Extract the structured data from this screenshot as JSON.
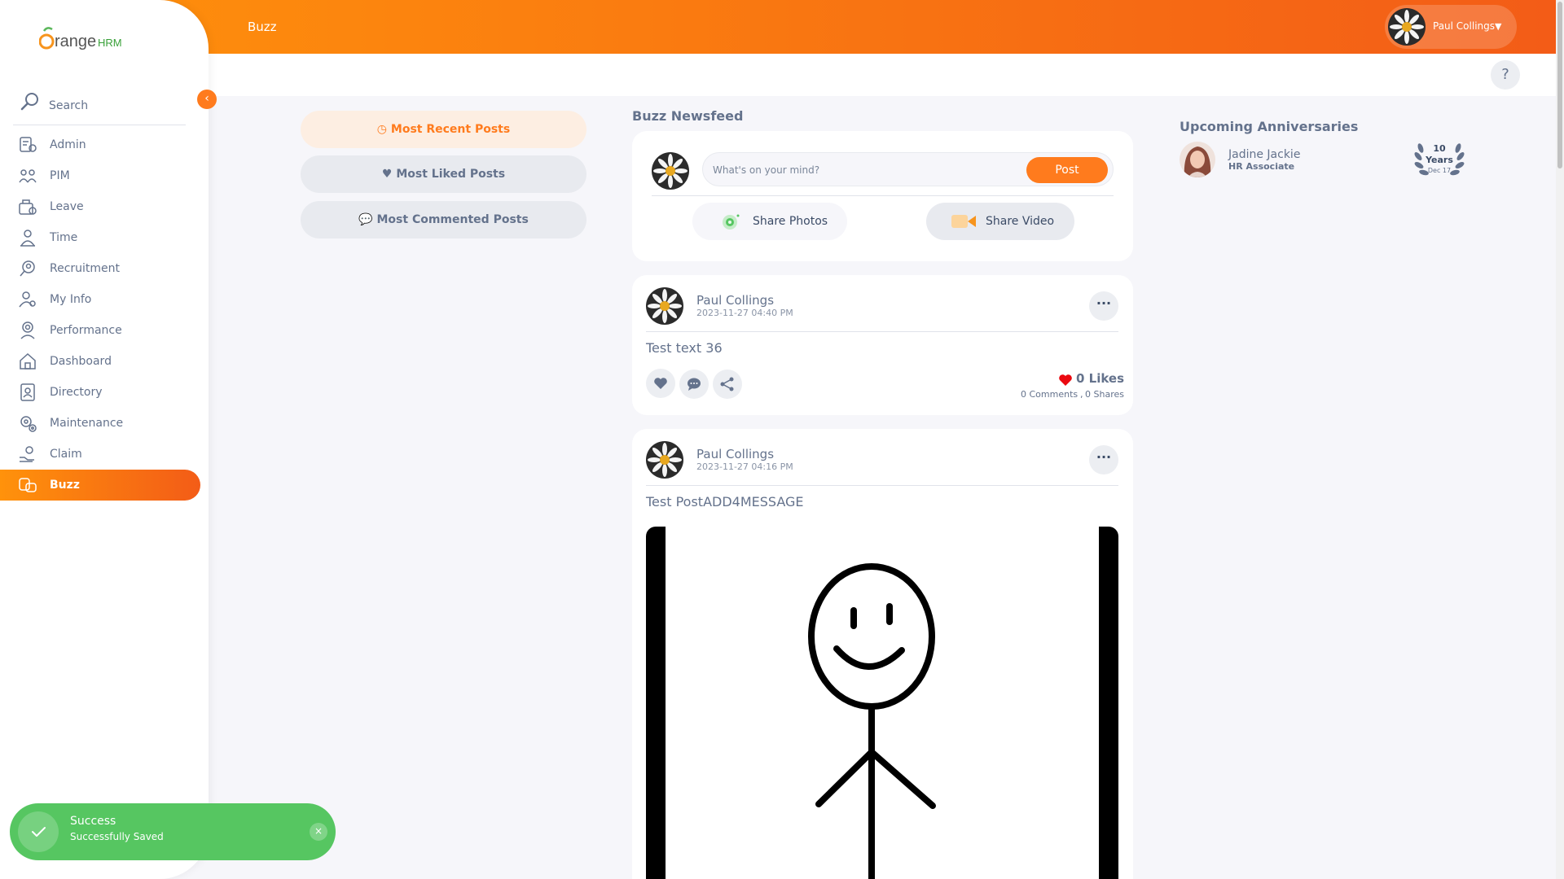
{
  "topbar": {
    "page_title": "Buzz",
    "user_name": "Paul Collings"
  },
  "sidebar": {
    "brand": {
      "main": "range",
      "accent": "HRM"
    },
    "search_label": "Search",
    "items": [
      {
        "label": "Admin",
        "icon": "admin-icon",
        "active": false
      },
      {
        "label": "PIM",
        "icon": "pim-icon",
        "active": false
      },
      {
        "label": "Leave",
        "icon": "leave-icon",
        "active": false
      },
      {
        "label": "Time",
        "icon": "time-icon",
        "active": false
      },
      {
        "label": "Recruitment",
        "icon": "recruitment-icon",
        "active": false
      },
      {
        "label": "My Info",
        "icon": "my-info-icon",
        "active": false
      },
      {
        "label": "Performance",
        "icon": "performance-icon",
        "active": false
      },
      {
        "label": "Dashboard",
        "icon": "dashboard-icon",
        "active": false
      },
      {
        "label": "Directory",
        "icon": "directory-icon",
        "active": false
      },
      {
        "label": "Maintenance",
        "icon": "maintenance-icon",
        "active": false
      },
      {
        "label": "Claim",
        "icon": "claim-icon",
        "active": false
      },
      {
        "label": "Buzz",
        "icon": "buzz-icon",
        "active": true
      }
    ]
  },
  "filters": {
    "recent": "Most Recent Posts",
    "liked": "Most Liked Posts",
    "commented": "Most Commented Posts"
  },
  "feed": {
    "title": "Buzz Newsfeed",
    "composer": {
      "placeholder": "What's on your mind?",
      "post_label": "Post",
      "share_photos": "Share Photos",
      "share_video": "Share Video"
    },
    "posts": [
      {
        "author": "Paul Collings",
        "time": "2023-11-27 04:40 PM",
        "text": "Test text 36",
        "likes": "0 Likes",
        "comments": "0 Comments",
        "shares": "0 Shares"
      },
      {
        "author": "Paul Collings",
        "time": "2023-11-27 04:16 PM",
        "text": "Test PostADD4MESSAGE"
      }
    ]
  },
  "anniversaries": {
    "title": "Upcoming Anniversaries",
    "items": [
      {
        "name": "Jadine Jackie",
        "role": "HR Associate",
        "years_num": "10",
        "years_label": "Years",
        "date": "Dec 17"
      }
    ]
  },
  "toast": {
    "title": "Success",
    "message": "Successfully Saved"
  },
  "help_label": "?",
  "colors": {
    "accent": "#ff7b1d",
    "success": "#56c661",
    "text": "#64728c"
  }
}
